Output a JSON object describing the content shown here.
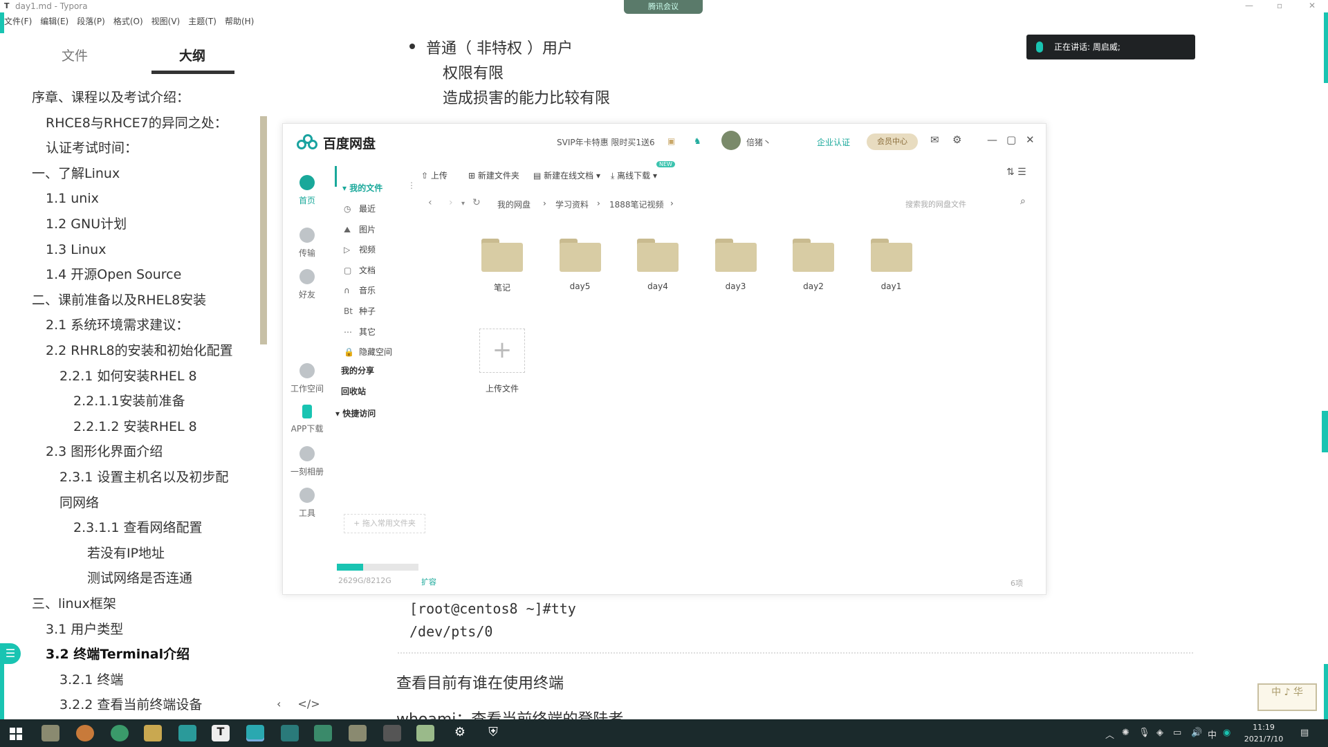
{
  "window": {
    "title": "day1.md - Typora",
    "meeting_label": "腾讯会议"
  },
  "menu": [
    "文件(F)",
    "编辑(E)",
    "段落(P)",
    "格式(O)",
    "视图(V)",
    "主题(T)",
    "帮助(H)"
  ],
  "sidebar": {
    "tab_files": "文件",
    "tab_outline": "大纲",
    "outline": [
      {
        "text": "序章、课程以及考试介绍：",
        "level": 1
      },
      {
        "text": "RHCE8与RHCE7的异同之处：",
        "level": 2
      },
      {
        "text": "认证考试时间：",
        "level": 2
      },
      {
        "text": "一、了解Linux",
        "level": 1
      },
      {
        "text": "1.1 unix",
        "level": 2
      },
      {
        "text": "1.2 GNU计划",
        "level": 2
      },
      {
        "text": "1.3 Linux",
        "level": 2
      },
      {
        "text": "1.4 开源Open Source",
        "level": 2
      },
      {
        "text": "二、课前准备以及RHEL8安装",
        "level": 1
      },
      {
        "text": "2.1 系统环境需求建议：",
        "level": 2
      },
      {
        "text": "2.2 RHRL8的安装和初始化配置",
        "level": 2
      },
      {
        "text": "2.2.1 如何安装RHEL 8",
        "level": 3
      },
      {
        "text": "2.2.1.1安装前准备",
        "level": 4
      },
      {
        "text": "2.2.1.2 安装RHEL 8",
        "level": 4
      },
      {
        "text": "2.3 图形化界面介绍",
        "level": 2
      },
      {
        "text": "2.3.1 设置主机名以及初步配",
        "level": 3
      },
      {
        "text": "同网络",
        "level": 3
      },
      {
        "text": "2.3.1.1 查看网络配置",
        "level": 4
      },
      {
        "text": "若没有IP地址",
        "level": 5
      },
      {
        "text": "测试网络是否连通",
        "level": 5
      },
      {
        "text": "三、linux框架",
        "level": 1
      },
      {
        "text": "3.1 用户类型",
        "level": 2
      },
      {
        "text": "3.2 终端Terminal介绍",
        "level": 2,
        "active": true
      },
      {
        "text": "3.2.1 终端",
        "level": 3
      },
      {
        "text": "3.2.2 查看当前终端设备",
        "level": 3
      }
    ],
    "footer_back": "‹",
    "footer_source": "</>"
  },
  "editor": {
    "bullet_title": "普通（ 非特权 ）用户",
    "line1": "权限有限",
    "line2": "造成损害的能力比较有限",
    "code1": "[root@centos8 ~]#tty",
    "code2": "/dev/pts/0",
    "heading": "查看目前有谁在使用终端",
    "whoami": "whoami：查看当前终端的登陆者",
    "speaking": "正在讲话: 周启威;",
    "stamp": "中 ♪ 华"
  },
  "netdisk": {
    "app_name": "百度网盘",
    "promo": "SVIP年卡特惠 限时买1送6",
    "username": "倍猪丶",
    "enterprise": "企业认证",
    "member_center": "会员中心",
    "nav": [
      {
        "label": "首页",
        "icon": "cloud-icon",
        "active": true
      },
      {
        "label": "传输",
        "icon": "transfer-icon"
      },
      {
        "label": "好友",
        "icon": "friends-icon"
      },
      {
        "label": "工作空间",
        "icon": "workspace-icon"
      },
      {
        "label": "APP下载",
        "icon": "phone-icon"
      },
      {
        "label": "一刻相册",
        "icon": "album-icon"
      },
      {
        "label": "工具",
        "icon": "tools-icon"
      }
    ],
    "tree": {
      "my_files": "我的文件",
      "items": [
        {
          "label": "最近",
          "icon": "◷"
        },
        {
          "label": "图片",
          "icon": "⛰"
        },
        {
          "label": "视频",
          "icon": "▷"
        },
        {
          "label": "文档",
          "icon": "▢"
        },
        {
          "label": "音乐",
          "icon": "∩"
        },
        {
          "label": "种子",
          "icon": "Bt"
        },
        {
          "label": "其它",
          "icon": "⋯"
        },
        {
          "label": "隐藏空间",
          "icon": "🔒"
        }
      ],
      "my_share": "我的分享",
      "recycle": "回收站",
      "quick_access": "快捷访问",
      "drag_hint": "+ 拖入常用文件夹"
    },
    "toolbar": {
      "upload": "上传",
      "new_folder": "新建文件夹",
      "new_online_doc": "新建在线文档",
      "new_badge": "NEW",
      "offline_download": "离线下载"
    },
    "breadcrumb": [
      "我的网盘",
      "学习资料",
      "1888笔记视频"
    ],
    "search_placeholder": "搜索我的网盘文件",
    "folders": [
      "笔记",
      "day5",
      "day4",
      "day3",
      "day2",
      "day1"
    ],
    "upload_tile_label": "上传文件",
    "storage": {
      "used_text": "2629G/8212G",
      "fraction": 0.32,
      "expand": "扩容"
    },
    "item_count": "6项"
  },
  "taskbar": {
    "time": "11:19",
    "date": "2021/7/10",
    "ime": "中"
  },
  "colors": {
    "accent": "#19c4b2",
    "folder": "#d8cca4",
    "taskbar": "#1b2a2c"
  }
}
